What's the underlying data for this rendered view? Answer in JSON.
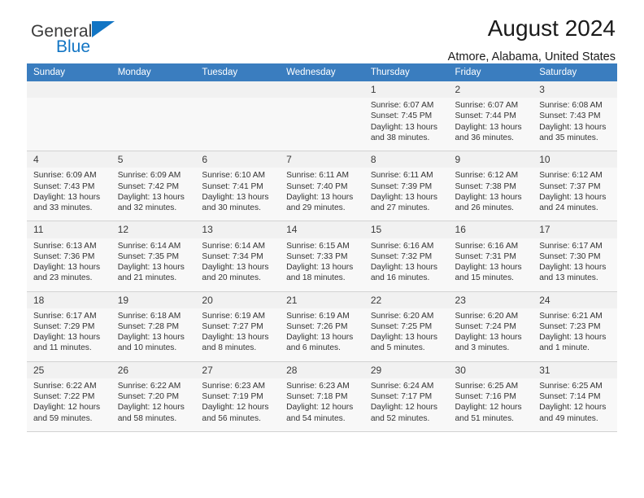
{
  "brand": {
    "name_part1": "General",
    "name_part2": "Blue",
    "accent_color": "#1275c4"
  },
  "header": {
    "title": "August 2024",
    "subtitle": "Atmore, Alabama, United States",
    "header_bg_color": "#3a7dbf"
  },
  "weekday_headers": [
    "Sunday",
    "Monday",
    "Tuesday",
    "Wednesday",
    "Thursday",
    "Friday",
    "Saturday"
  ],
  "weeks": [
    [
      {
        "day": "",
        "sunrise": "",
        "sunset": "",
        "daylight1": "",
        "daylight2": "",
        "empty": true
      },
      {
        "day": "",
        "sunrise": "",
        "sunset": "",
        "daylight1": "",
        "daylight2": "",
        "empty": true
      },
      {
        "day": "",
        "sunrise": "",
        "sunset": "",
        "daylight1": "",
        "daylight2": "",
        "empty": true
      },
      {
        "day": "",
        "sunrise": "",
        "sunset": "",
        "daylight1": "",
        "daylight2": "",
        "empty": true
      },
      {
        "day": "1",
        "sunrise": "Sunrise: 6:07 AM",
        "sunset": "Sunset: 7:45 PM",
        "daylight1": "Daylight: 13 hours",
        "daylight2": "and 38 minutes."
      },
      {
        "day": "2",
        "sunrise": "Sunrise: 6:07 AM",
        "sunset": "Sunset: 7:44 PM",
        "daylight1": "Daylight: 13 hours",
        "daylight2": "and 36 minutes."
      },
      {
        "day": "3",
        "sunrise": "Sunrise: 6:08 AM",
        "sunset": "Sunset: 7:43 PM",
        "daylight1": "Daylight: 13 hours",
        "daylight2": "and 35 minutes."
      }
    ],
    [
      {
        "day": "4",
        "sunrise": "Sunrise: 6:09 AM",
        "sunset": "Sunset: 7:43 PM",
        "daylight1": "Daylight: 13 hours",
        "daylight2": "and 33 minutes."
      },
      {
        "day": "5",
        "sunrise": "Sunrise: 6:09 AM",
        "sunset": "Sunset: 7:42 PM",
        "daylight1": "Daylight: 13 hours",
        "daylight2": "and 32 minutes."
      },
      {
        "day": "6",
        "sunrise": "Sunrise: 6:10 AM",
        "sunset": "Sunset: 7:41 PM",
        "daylight1": "Daylight: 13 hours",
        "daylight2": "and 30 minutes."
      },
      {
        "day": "7",
        "sunrise": "Sunrise: 6:11 AM",
        "sunset": "Sunset: 7:40 PM",
        "daylight1": "Daylight: 13 hours",
        "daylight2": "and 29 minutes."
      },
      {
        "day": "8",
        "sunrise": "Sunrise: 6:11 AM",
        "sunset": "Sunset: 7:39 PM",
        "daylight1": "Daylight: 13 hours",
        "daylight2": "and 27 minutes."
      },
      {
        "day": "9",
        "sunrise": "Sunrise: 6:12 AM",
        "sunset": "Sunset: 7:38 PM",
        "daylight1": "Daylight: 13 hours",
        "daylight2": "and 26 minutes."
      },
      {
        "day": "10",
        "sunrise": "Sunrise: 6:12 AM",
        "sunset": "Sunset: 7:37 PM",
        "daylight1": "Daylight: 13 hours",
        "daylight2": "and 24 minutes."
      }
    ],
    [
      {
        "day": "11",
        "sunrise": "Sunrise: 6:13 AM",
        "sunset": "Sunset: 7:36 PM",
        "daylight1": "Daylight: 13 hours",
        "daylight2": "and 23 minutes."
      },
      {
        "day": "12",
        "sunrise": "Sunrise: 6:14 AM",
        "sunset": "Sunset: 7:35 PM",
        "daylight1": "Daylight: 13 hours",
        "daylight2": "and 21 minutes."
      },
      {
        "day": "13",
        "sunrise": "Sunrise: 6:14 AM",
        "sunset": "Sunset: 7:34 PM",
        "daylight1": "Daylight: 13 hours",
        "daylight2": "and 20 minutes."
      },
      {
        "day": "14",
        "sunrise": "Sunrise: 6:15 AM",
        "sunset": "Sunset: 7:33 PM",
        "daylight1": "Daylight: 13 hours",
        "daylight2": "and 18 minutes."
      },
      {
        "day": "15",
        "sunrise": "Sunrise: 6:16 AM",
        "sunset": "Sunset: 7:32 PM",
        "daylight1": "Daylight: 13 hours",
        "daylight2": "and 16 minutes."
      },
      {
        "day": "16",
        "sunrise": "Sunrise: 6:16 AM",
        "sunset": "Sunset: 7:31 PM",
        "daylight1": "Daylight: 13 hours",
        "daylight2": "and 15 minutes."
      },
      {
        "day": "17",
        "sunrise": "Sunrise: 6:17 AM",
        "sunset": "Sunset: 7:30 PM",
        "daylight1": "Daylight: 13 hours",
        "daylight2": "and 13 minutes."
      }
    ],
    [
      {
        "day": "18",
        "sunrise": "Sunrise: 6:17 AM",
        "sunset": "Sunset: 7:29 PM",
        "daylight1": "Daylight: 13 hours",
        "daylight2": "and 11 minutes."
      },
      {
        "day": "19",
        "sunrise": "Sunrise: 6:18 AM",
        "sunset": "Sunset: 7:28 PM",
        "daylight1": "Daylight: 13 hours",
        "daylight2": "and 10 minutes."
      },
      {
        "day": "20",
        "sunrise": "Sunrise: 6:19 AM",
        "sunset": "Sunset: 7:27 PM",
        "daylight1": "Daylight: 13 hours",
        "daylight2": "and 8 minutes."
      },
      {
        "day": "21",
        "sunrise": "Sunrise: 6:19 AM",
        "sunset": "Sunset: 7:26 PM",
        "daylight1": "Daylight: 13 hours",
        "daylight2": "and 6 minutes."
      },
      {
        "day": "22",
        "sunrise": "Sunrise: 6:20 AM",
        "sunset": "Sunset: 7:25 PM",
        "daylight1": "Daylight: 13 hours",
        "daylight2": "and 5 minutes."
      },
      {
        "day": "23",
        "sunrise": "Sunrise: 6:20 AM",
        "sunset": "Sunset: 7:24 PM",
        "daylight1": "Daylight: 13 hours",
        "daylight2": "and 3 minutes."
      },
      {
        "day": "24",
        "sunrise": "Sunrise: 6:21 AM",
        "sunset": "Sunset: 7:23 PM",
        "daylight1": "Daylight: 13 hours",
        "daylight2": "and 1 minute."
      }
    ],
    [
      {
        "day": "25",
        "sunrise": "Sunrise: 6:22 AM",
        "sunset": "Sunset: 7:22 PM",
        "daylight1": "Daylight: 12 hours",
        "daylight2": "and 59 minutes."
      },
      {
        "day": "26",
        "sunrise": "Sunrise: 6:22 AM",
        "sunset": "Sunset: 7:20 PM",
        "daylight1": "Daylight: 12 hours",
        "daylight2": "and 58 minutes."
      },
      {
        "day": "27",
        "sunrise": "Sunrise: 6:23 AM",
        "sunset": "Sunset: 7:19 PM",
        "daylight1": "Daylight: 12 hours",
        "daylight2": "and 56 minutes."
      },
      {
        "day": "28",
        "sunrise": "Sunrise: 6:23 AM",
        "sunset": "Sunset: 7:18 PM",
        "daylight1": "Daylight: 12 hours",
        "daylight2": "and 54 minutes."
      },
      {
        "day": "29",
        "sunrise": "Sunrise: 6:24 AM",
        "sunset": "Sunset: 7:17 PM",
        "daylight1": "Daylight: 12 hours",
        "daylight2": "and 52 minutes."
      },
      {
        "day": "30",
        "sunrise": "Sunrise: 6:25 AM",
        "sunset": "Sunset: 7:16 PM",
        "daylight1": "Daylight: 12 hours",
        "daylight2": "and 51 minutes."
      },
      {
        "day": "31",
        "sunrise": "Sunrise: 6:25 AM",
        "sunset": "Sunset: 7:14 PM",
        "daylight1": "Daylight: 12 hours",
        "daylight2": "and 49 minutes."
      }
    ]
  ]
}
